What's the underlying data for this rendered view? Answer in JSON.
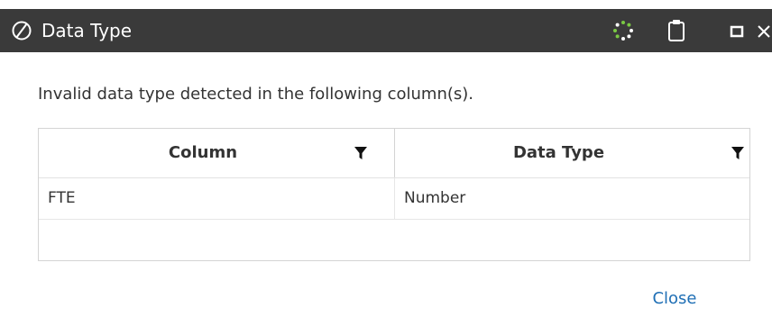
{
  "window": {
    "title": "Data Type",
    "icons": {
      "app": "no-symbol-icon",
      "busy": "loading-spinner-icon",
      "clipboard": "clipboard-icon",
      "maximize": "maximize-icon",
      "close": "close-icon"
    },
    "colors": {
      "titlebar": "#3a3a3a",
      "spinner": "#7ac943",
      "accent": "#1f6fb5"
    }
  },
  "message": "Invalid data type detected in the following column(s).",
  "table": {
    "columns": [
      "Column",
      "Data Type"
    ],
    "rows": [
      [
        "FTE",
        "Number"
      ],
      [
        "",
        ""
      ]
    ],
    "filter_icon": "filter-icon"
  },
  "footer": {
    "close_label": "Close"
  }
}
